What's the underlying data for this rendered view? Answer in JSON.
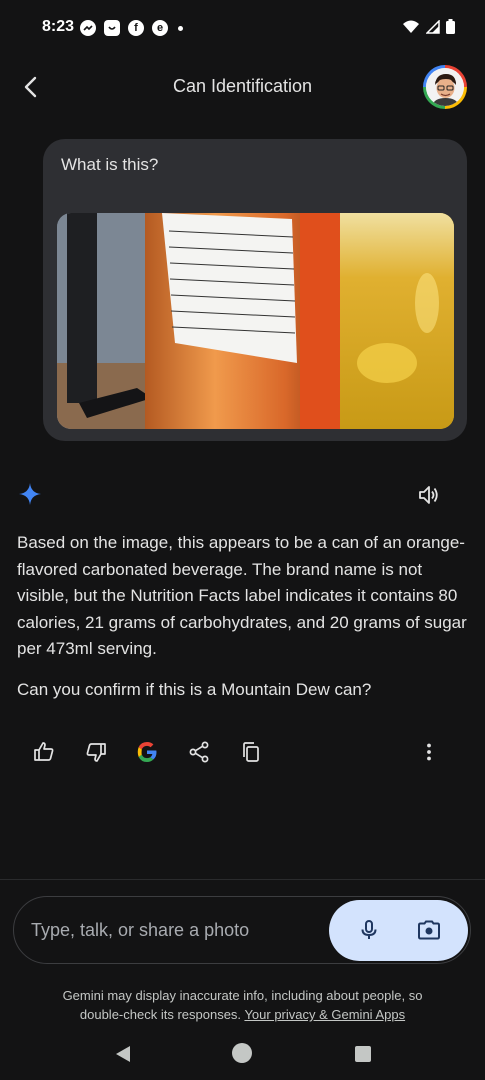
{
  "status_bar": {
    "time": "8:23",
    "left_icons": [
      "messenger-icon",
      "shopping-bag-icon",
      "facebook-icon",
      "edge-icon",
      "dot-icon"
    ],
    "right_icons": [
      "wifi-icon",
      "signal-icon",
      "battery-icon"
    ]
  },
  "header": {
    "title": "Can Identification",
    "back_icon": "back-arrow-icon",
    "avatar": "user-avatar"
  },
  "conversation": {
    "user_message": "What is this?",
    "user_image": "orange-can-photo",
    "response_paragraphs": [
      "Based on the image, this appears to be a can of an orange-flavored carbonated beverage. The brand name is not visible, but the Nutrition Facts label indicates it contains 80 calories, 21 grams of carbohydrates, and 20 grams of sugar per 473ml serving.",
      "Can you confirm if this is a Mountain Dew can?"
    ],
    "actions": [
      "thumbs-up-icon",
      "thumbs-down-icon",
      "google-icon",
      "share-icon",
      "copy-icon",
      "more-icon"
    ]
  },
  "input": {
    "placeholder": "Type, talk, or share a photo"
  },
  "disclaimer": {
    "text": "Gemini may display inaccurate info, including about people, so double-check its responses.",
    "link": "Your privacy & Gemini Apps"
  },
  "colors": {
    "background": "#131314",
    "bubble": "#2e2f33",
    "pill": "#d3e3fd",
    "sparkle": "#4285f4"
  }
}
